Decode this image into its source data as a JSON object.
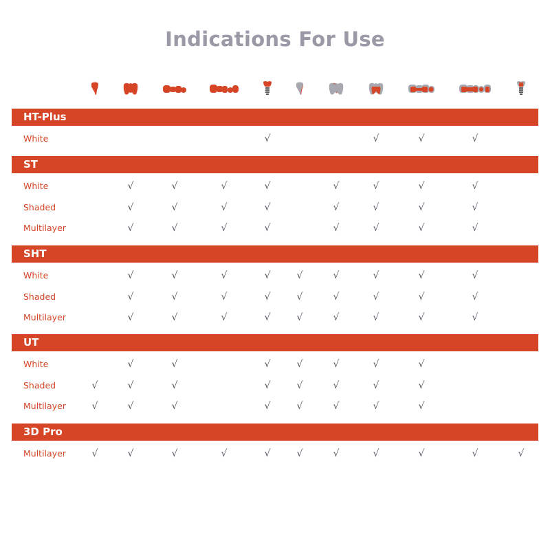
{
  "title": "Indications For Use",
  "colors": {
    "accent": "#d64526",
    "title": "#9a99a6",
    "check": "#555a60",
    "tooth_gray": "#a8a8b0"
  },
  "check_symbol": "√",
  "columns": [
    {
      "icon": "veneer-icon"
    },
    {
      "icon": "crown-icon"
    },
    {
      "icon": "three-unit-bridge-icon"
    },
    {
      "icon": "multi-unit-bridge-icon"
    },
    {
      "icon": "implant-crown-icon"
    },
    {
      "icon": "veneer-cutback-icon"
    },
    {
      "icon": "crown-cutback-icon"
    },
    {
      "icon": "crown-coping-icon"
    },
    {
      "icon": "three-unit-bridge-framework-icon"
    },
    {
      "icon": "multi-unit-bridge-framework-icon"
    },
    {
      "icon": "implant-abutment-icon"
    }
  ],
  "sections": [
    {
      "name": "HT-Plus",
      "rows": [
        {
          "label": "White",
          "checks": [
            false,
            false,
            false,
            false,
            true,
            false,
            false,
            true,
            true,
            true,
            false
          ]
        }
      ]
    },
    {
      "name": "ST",
      "rows": [
        {
          "label": "White",
          "checks": [
            false,
            true,
            true,
            true,
            true,
            false,
            true,
            true,
            true,
            true,
            false
          ]
        },
        {
          "label": "Shaded",
          "checks": [
            false,
            true,
            true,
            true,
            true,
            false,
            true,
            true,
            true,
            true,
            false
          ]
        },
        {
          "label": "Multilayer",
          "checks": [
            false,
            true,
            true,
            true,
            true,
            false,
            true,
            true,
            true,
            true,
            false
          ]
        }
      ]
    },
    {
      "name": "SHT",
      "rows": [
        {
          "label": "White",
          "checks": [
            false,
            true,
            true,
            true,
            true,
            true,
            true,
            true,
            true,
            true,
            false
          ]
        },
        {
          "label": "Shaded",
          "checks": [
            false,
            true,
            true,
            true,
            true,
            true,
            true,
            true,
            true,
            true,
            false
          ]
        },
        {
          "label": "Multilayer",
          "checks": [
            false,
            true,
            true,
            true,
            true,
            true,
            true,
            true,
            true,
            true,
            false
          ]
        }
      ]
    },
    {
      "name": "UT",
      "rows": [
        {
          "label": "White",
          "checks": [
            false,
            true,
            true,
            false,
            true,
            true,
            true,
            true,
            true,
            false,
            false
          ]
        },
        {
          "label": "Shaded",
          "checks": [
            true,
            true,
            true,
            false,
            true,
            true,
            true,
            true,
            true,
            false,
            false
          ]
        },
        {
          "label": "Multilayer",
          "checks": [
            true,
            true,
            true,
            false,
            true,
            true,
            true,
            true,
            true,
            false,
            false
          ]
        }
      ]
    },
    {
      "name": "3D Pro",
      "rows": [
        {
          "label": "Multilayer",
          "checks": [
            true,
            true,
            true,
            true,
            true,
            true,
            true,
            true,
            true,
            true,
            true
          ]
        }
      ]
    }
  ]
}
